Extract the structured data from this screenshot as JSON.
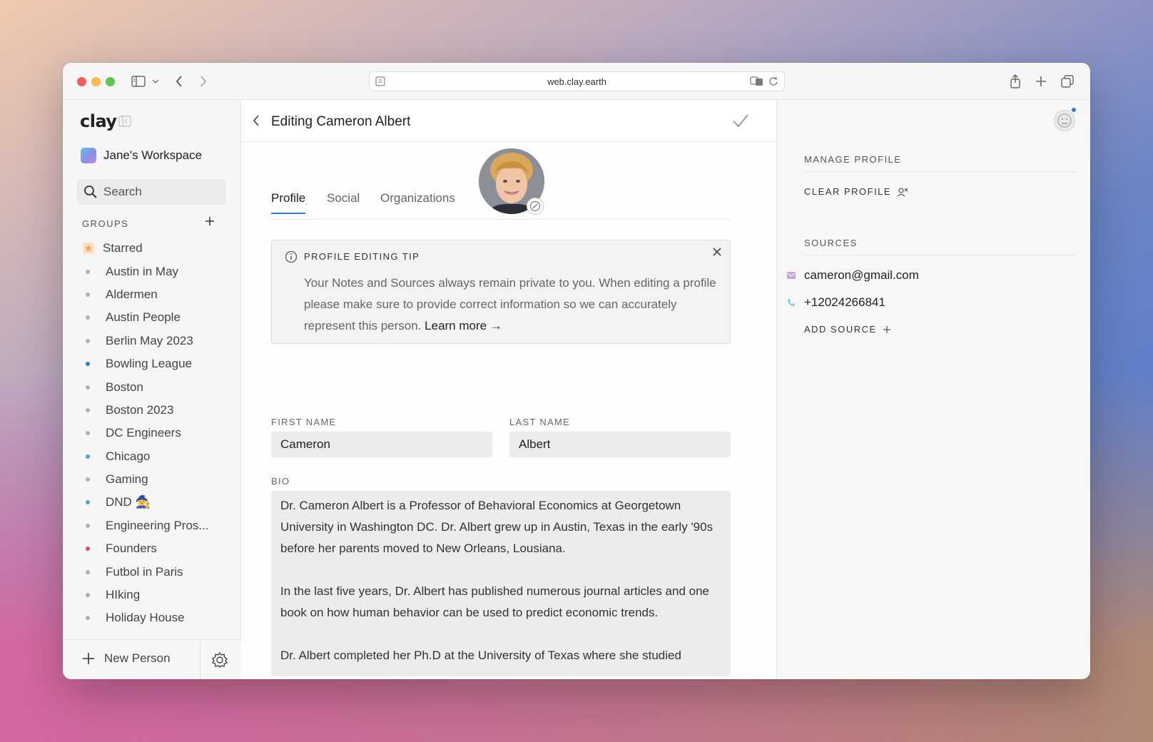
{
  "browser": {
    "url": "web.clay.earth"
  },
  "app": {
    "logo": "clay",
    "workspace": "Jane's Workspace"
  },
  "search": {
    "placeholder": "Search"
  },
  "groups": {
    "header": "GROUPS",
    "items": [
      {
        "label": "Starred",
        "type": "starred",
        "color": "#f5a35c"
      },
      {
        "label": "Austin in May",
        "color": "#b0b0b0"
      },
      {
        "label": "Aldermen",
        "color": "#b0b0b0"
      },
      {
        "label": "Austin People",
        "color": "#b0b0b0"
      },
      {
        "label": "Berlin May 2023",
        "color": "#b0b0b0"
      },
      {
        "label": "Bowling League",
        "color": "#2f7fbf"
      },
      {
        "label": "Boston",
        "color": "#b0b0b0"
      },
      {
        "label": "Boston 2023",
        "color": "#b0b0b0"
      },
      {
        "label": "DC Engineers",
        "color": "#b0b0b0"
      },
      {
        "label": "Chicago",
        "color": "#4aa6c9"
      },
      {
        "label": "Gaming",
        "color": "#b0b0b0"
      },
      {
        "label": "DND 🧙",
        "color": "#4aa6c9"
      },
      {
        "label": "Engineering Pros...",
        "color": "#b0b0b0"
      },
      {
        "label": "Founders",
        "color": "#e0506a"
      },
      {
        "label": "Futbol in Paris",
        "color": "#b0b0b0"
      },
      {
        "label": "HIking",
        "color": "#b0b0b0"
      },
      {
        "label": "Holiday House",
        "color": "#b0b0b0"
      }
    ]
  },
  "sidebar_bottom": {
    "new_person": "New Person"
  },
  "editor": {
    "title": "Editing Cameron Albert",
    "tabs": [
      {
        "label": "Profile",
        "active": true
      },
      {
        "label": "Social",
        "active": false
      },
      {
        "label": "Organizations",
        "active": false
      }
    ],
    "tip": {
      "title": "PROFILE EDITING TIP",
      "body": "Your Notes and Sources always remain private to you. When editing a profile please make sure to provide correct information so we can accurately represent this person.",
      "link": "Learn more →"
    },
    "first_name": {
      "label": "FIRST NAME",
      "value": "Cameron"
    },
    "last_name": {
      "label": "LAST NAME",
      "value": "Albert"
    },
    "bio": {
      "label": "BIO",
      "paragraphs": [
        "Dr. Cameron Albert is a Professor of Behavioral Economics at Georgetown University in Washington DC. Dr. Albert grew up in Austin, Texas in the early '90s before her parents moved to New Orleans, Lousiana.",
        "In the last five years, Dr. Albert has published numerous journal articles and one book on how human behavior can be used to predict economic trends.",
        "Dr. Albert completed her Ph.D at the University of Texas where she studied"
      ]
    }
  },
  "right_panel": {
    "manage_label": "MANAGE PROFILE",
    "clear_profile": "CLEAR PROFILE",
    "sources_label": "SOURCES",
    "sources": [
      {
        "type": "email",
        "value": "cameron@gmail.com",
        "color": "#a070c0"
      },
      {
        "type": "phone",
        "value": "+12024266841",
        "color": "#4ab5c9"
      }
    ],
    "add_source": "ADD SOURCE"
  }
}
